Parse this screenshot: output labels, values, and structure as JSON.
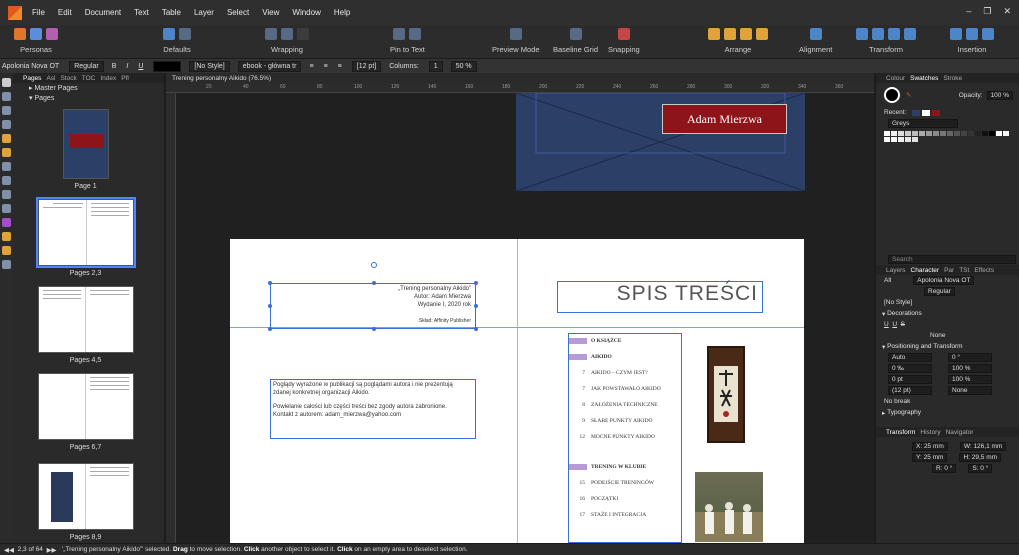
{
  "menu": {
    "items": [
      "File",
      "Edit",
      "Document",
      "Text",
      "Table",
      "Layer",
      "Select",
      "View",
      "Window",
      "Help"
    ]
  },
  "toolbar": {
    "groups": [
      "Personas",
      "Defaults",
      "Wrapping",
      "Pin to Text",
      "Preview Mode",
      "Baseline Grid",
      "Snapping",
      "Arrange",
      "Alignment",
      "Transform",
      "Insertion"
    ]
  },
  "context": {
    "font": "Apolonia Nova OT",
    "weight": "Regular",
    "style": "[No Style]",
    "paragraph_style": "ebook - główna tr",
    "size": "[12 pt]",
    "columns_label": "Columns:",
    "columns_value": "1",
    "percent": "50 %"
  },
  "pages_panel": {
    "tabs": [
      "Pages",
      "Asl",
      "Stock",
      "TOC",
      "Index",
      "Pfl"
    ],
    "master_pages": "Master Pages",
    "pages": "Pages",
    "thumbnails": [
      "Page 1",
      "Pages 2,3",
      "Pages 4,5",
      "Pages 6,7",
      "Pages 8,9"
    ]
  },
  "document": {
    "tab_title": "Trening personalny Aikido (76.5%)",
    "cover_name": "Adam Mierzwa",
    "credits": [
      "„Trening personalny Aikido”",
      "Autor: Adam Mierzwa",
      "Wydanie I, 2020 rok",
      "Skład: Affinity Publisher"
    ],
    "disclaimer": [
      "Poglądy wyrażone w publikacji są poglądami autora i nie prezentują",
      "zdanej konkretnej organizacji Aikido.",
      "",
      "Powielanie całości lub części treści bez zgody autora zabronione.",
      "Kontakt z autorem: adam_mierzwa@yahoo.com"
    ],
    "toc_title": "SPIS TREŚCI",
    "toc": [
      {
        "num": "",
        "label": "O KSIĄŻCE",
        "head": true
      },
      {
        "num": "",
        "label": "AIKIDO",
        "head": true
      },
      {
        "num": "7",
        "label": "AIKIDO – CZYM JEST?",
        "head": false
      },
      {
        "num": "7",
        "label": "JAK POWSTAWAŁO AIKIDO",
        "head": false
      },
      {
        "num": "8",
        "label": "ZAŁOŻENIA TECHNICZNE",
        "head": false
      },
      {
        "num": "9",
        "label": "SŁABE PUNKTY AIKIDO",
        "head": false
      },
      {
        "num": "12",
        "label": "MOCNE PUNKTY AIKIDO",
        "head": false
      },
      {
        "num": "",
        "label": "TRENING W KLUBIE",
        "head": true
      },
      {
        "num": "15",
        "label": "PODEJŚCIE TRENINGÓW",
        "head": false
      },
      {
        "num": "16",
        "label": "POCZĄTKI",
        "head": false
      },
      {
        "num": "17",
        "label": "STAŻE I INTEGRACJA",
        "head": false
      }
    ],
    "ruler_ticks": [
      "20",
      "40",
      "60",
      "80",
      "100",
      "120",
      "140",
      "160",
      "180",
      "200",
      "220",
      "240",
      "260",
      "280",
      "300",
      "320",
      "340",
      "360"
    ]
  },
  "right_panel": {
    "top_tabs": [
      "Colour",
      "Swatches",
      "Stroke"
    ],
    "opacity_label": "Opacity:",
    "opacity": "100 %",
    "recent_label": "Recent:",
    "palette": "Greys",
    "search_placeholder": "Search",
    "mid_tabs": [
      "Layers",
      "Character",
      "Par",
      "TSt",
      "Effects"
    ],
    "char_all": "All",
    "char_font": "Apolonia Nova OT",
    "char_weight": "Regular",
    "char_style": "[No Style]",
    "decorations": "Decorations",
    "none": "None",
    "pos_transform": "Positioning and Transform",
    "fields": [
      {
        "l": "Auto",
        "r": "0 °"
      },
      {
        "l": "0 ‰",
        "r": "100 %"
      },
      {
        "l": "0 pt",
        "r": "100 %"
      },
      {
        "l": "(12 pt)",
        "r": "None"
      }
    ],
    "no_break": "No break",
    "typography": "Typography",
    "bottom_tabs": [
      "Transform",
      "History",
      "Navigator"
    ],
    "transform": {
      "x": "X: 25 mm",
      "w": "W: 126,1 mm",
      "y": "Y: 25 mm",
      "h": "H: 29,5 mm",
      "r": "R: 0 °",
      "s": "S: 0 °"
    }
  },
  "status": {
    "page_info": "2,3 of 64",
    "message_1": "'„Trening personalny Aikido”' selected.",
    "drag": "Drag",
    "message_2": "to move selection.",
    "click": "Click",
    "message_3": "another object to select it.",
    "click2": "Click",
    "message_4": "on an empty area to deselect selection."
  }
}
